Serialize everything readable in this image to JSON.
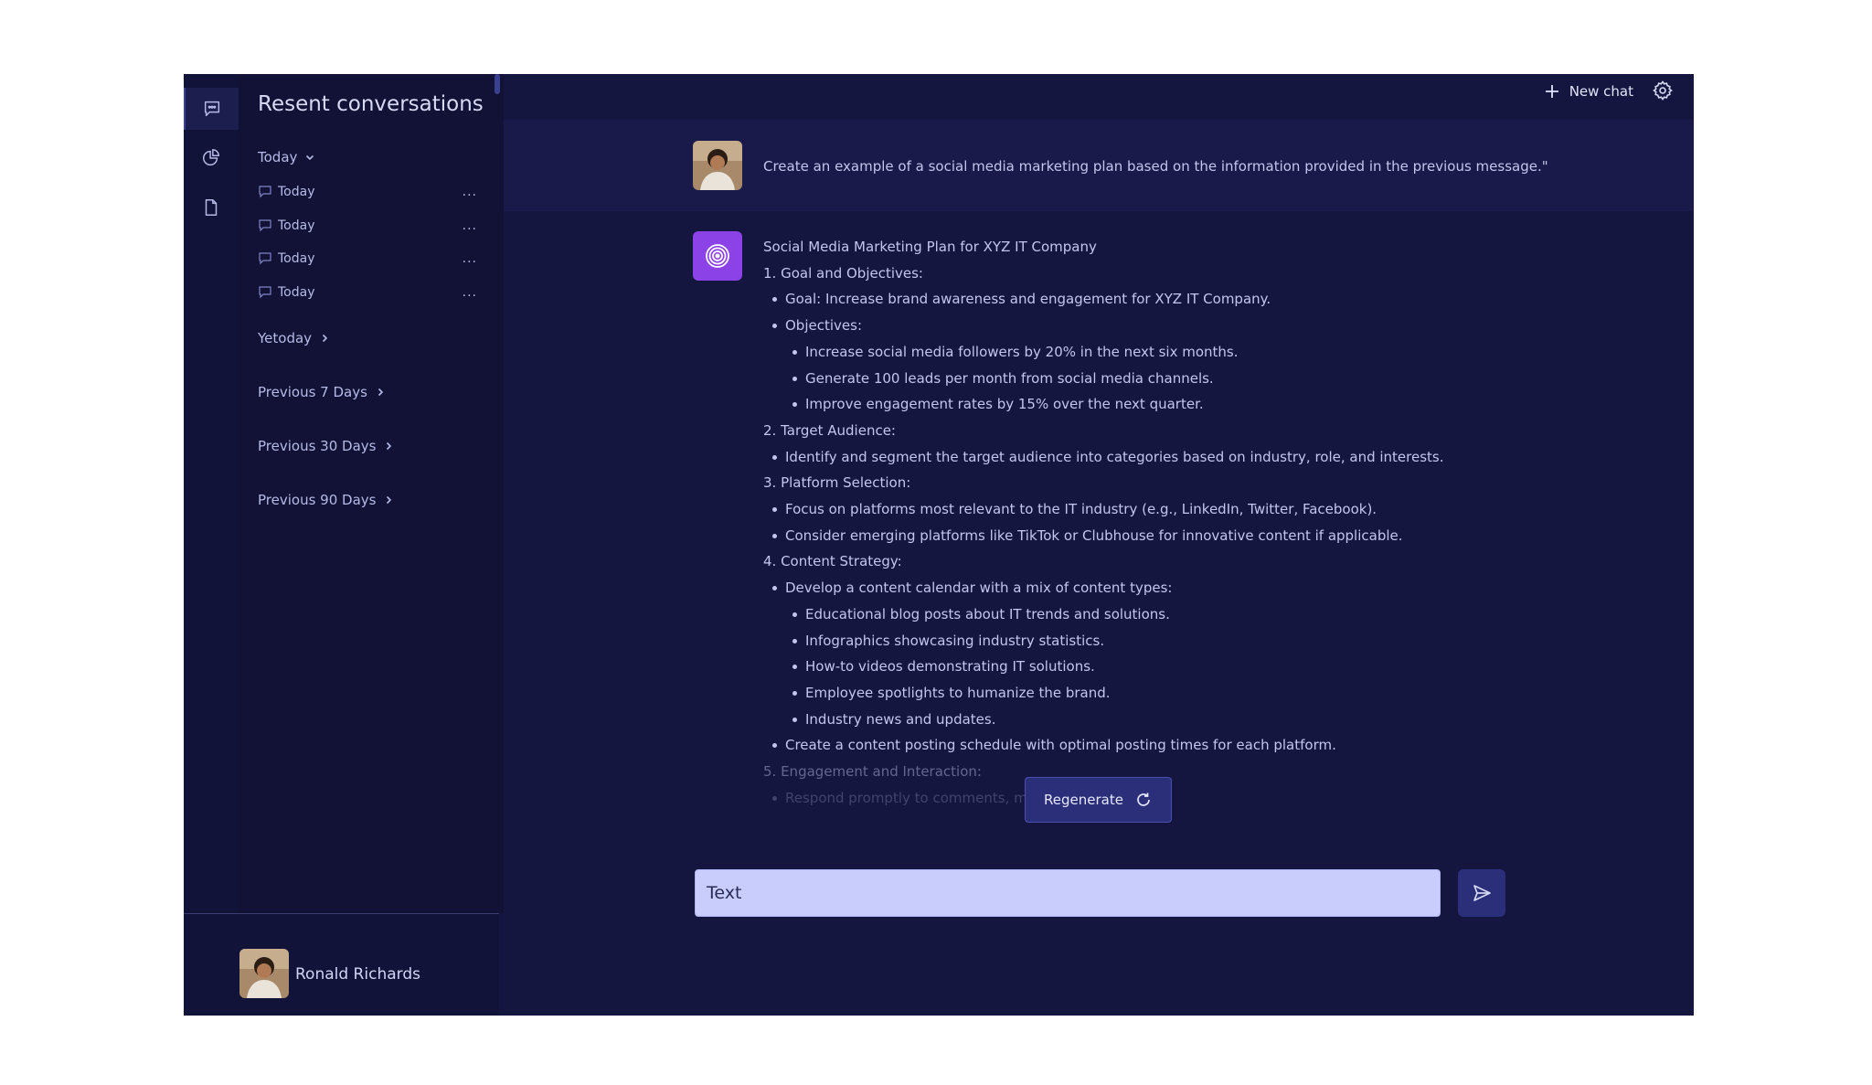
{
  "sidebar": {
    "title": "Resent conversations",
    "groups": [
      {
        "label": "Today",
        "expanded": true
      },
      {
        "label": "Yetoday",
        "expanded": false
      },
      {
        "label": "Previous 7 Days",
        "expanded": false
      },
      {
        "label": "Previous 30 Days",
        "expanded": false
      },
      {
        "label": "Previous 90 Days",
        "expanded": false
      }
    ],
    "today_items": [
      {
        "label": "Today",
        "more": "..."
      },
      {
        "label": "Today",
        "more": "..."
      },
      {
        "label": "Today",
        "more": "..."
      },
      {
        "label": "Today",
        "more": "..."
      }
    ],
    "profile_name": "Ronald Richards"
  },
  "rail": {
    "icons": [
      "chat-icon",
      "pie-chart-icon",
      "document-icon"
    ]
  },
  "topbar": {
    "new_chat_label": "New chat",
    "settings_icon": "gear-icon"
  },
  "conversation": {
    "user_message": "Create an example of a social media marketing plan based on the information provided in the previous message.\"",
    "bot_lines": [
      {
        "level": 0,
        "text": "Social Media Marketing Plan for XYZ IT Company"
      },
      {
        "level": 0,
        "text": "1. Goal and Objectives:"
      },
      {
        "level": 1,
        "text": "Goal: Increase brand awareness and engagement for XYZ IT Company."
      },
      {
        "level": 1,
        "text": "Objectives:"
      },
      {
        "level": 2,
        "text": "Increase social media followers by 20% in the next six months."
      },
      {
        "level": 2,
        "text": "Generate 100 leads per month from social media channels."
      },
      {
        "level": 2,
        "text": "Improve engagement rates by 15% over the next quarter."
      },
      {
        "level": 0,
        "text": "2. Target Audience:"
      },
      {
        "level": 1,
        "text": "Identify and segment the target audience into categories based on industry, role, and interests."
      },
      {
        "level": 0,
        "text": "3. Platform Selection:"
      },
      {
        "level": 1,
        "text": "Focus on platforms most relevant to the IT industry (e.g., LinkedIn, Twitter, Facebook)."
      },
      {
        "level": 1,
        "text": "Consider emerging platforms like TikTok or Clubhouse for innovative content if applicable."
      },
      {
        "level": 0,
        "text": "4. Content Strategy:"
      },
      {
        "level": 1,
        "text": "Develop a content calendar with a mix of content types:"
      },
      {
        "level": 2,
        "text": "Educational blog posts about IT trends and solutions."
      },
      {
        "level": 2,
        "text": "Infographics showcasing industry statistics."
      },
      {
        "level": 2,
        "text": "How-to videos demonstrating IT solutions."
      },
      {
        "level": 2,
        "text": "Employee spotlights to humanize the brand."
      },
      {
        "level": 2,
        "text": "Industry news and updates."
      },
      {
        "level": 1,
        "text": "Create a content posting schedule with optimal posting times for each platform."
      },
      {
        "level": 0,
        "text": "5. Engagement and Interaction:",
        "fade": 1
      },
      {
        "level": 1,
        "text": "Respond promptly to comments, mess",
        "fade": 2
      }
    ],
    "regenerate_label": "Regenerate"
  },
  "composer": {
    "value": "Text"
  },
  "colors": {
    "background": "#15163f",
    "sidebar": "#111235",
    "accent": "#2b2e78",
    "bot_avatar": "#8b43e8",
    "input": "#c9cdfb"
  }
}
